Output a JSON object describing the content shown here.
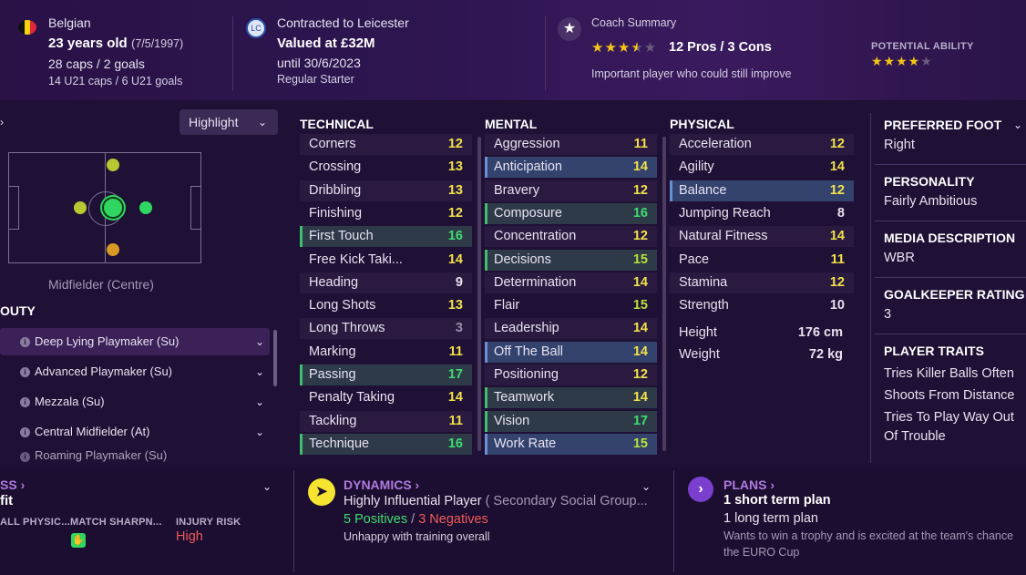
{
  "header": {
    "nationality": "Belgian",
    "age": "23 years old",
    "dob": "(7/5/1997)",
    "caps": "28 caps / 2 goals",
    "u21": "14 U21 caps / 6 U21 goals",
    "contract_title": "Contracted to Leicester",
    "value": "Valued at £32M",
    "until": "until 30/6/2023",
    "status": "Regular Starter",
    "coach_title": "Coach Summary",
    "coach_rating": 3.5,
    "pros_cons": "12 Pros / 3 Cons",
    "coach_note": "Important player who could still improve",
    "pa_label": "POTENTIAL ABILITY",
    "pa_rating": 4
  },
  "position": {
    "highlight_label": "Highlight",
    "position_name": "Midfielder (Centre)",
    "duty_label": "OUTY",
    "roles": [
      "Deep Lying Playmaker (Su)",
      "Advanced Playmaker (Su)",
      "Mezzala (Su)",
      "Central Midfielder (At)",
      "Roaming Playmaker (Su)"
    ]
  },
  "attributes": {
    "technical_title": "TECHNICAL",
    "mental_title": "MENTAL",
    "physical_title": "PHYSICAL",
    "technical": [
      {
        "name": "Corners",
        "value": "12"
      },
      {
        "name": "Crossing",
        "value": "13"
      },
      {
        "name": "Dribbling",
        "value": "13"
      },
      {
        "name": "Finishing",
        "value": "12"
      },
      {
        "name": "First Touch",
        "value": "16"
      },
      {
        "name": "Free Kick Taki...",
        "value": "14"
      },
      {
        "name": "Heading",
        "value": "9"
      },
      {
        "name": "Long Shots",
        "value": "13"
      },
      {
        "name": "Long Throws",
        "value": "3"
      },
      {
        "name": "Marking",
        "value": "11"
      },
      {
        "name": "Passing",
        "value": "17"
      },
      {
        "name": "Penalty Taking",
        "value": "14"
      },
      {
        "name": "Tackling",
        "value": "11"
      },
      {
        "name": "Technique",
        "value": "16"
      }
    ],
    "mental": [
      {
        "name": "Aggression",
        "value": "11"
      },
      {
        "name": "Anticipation",
        "value": "14"
      },
      {
        "name": "Bravery",
        "value": "12"
      },
      {
        "name": "Composure",
        "value": "16"
      },
      {
        "name": "Concentration",
        "value": "12"
      },
      {
        "name": "Decisions",
        "value": "15"
      },
      {
        "name": "Determination",
        "value": "14"
      },
      {
        "name": "Flair",
        "value": "15"
      },
      {
        "name": "Leadership",
        "value": "14"
      },
      {
        "name": "Off The Ball",
        "value": "14"
      },
      {
        "name": "Positioning",
        "value": "12"
      },
      {
        "name": "Teamwork",
        "value": "14"
      },
      {
        "name": "Vision",
        "value": "17"
      },
      {
        "name": "Work Rate",
        "value": "15"
      }
    ],
    "physical": [
      {
        "name": "Acceleration",
        "value": "12"
      },
      {
        "name": "Agility",
        "value": "14"
      },
      {
        "name": "Balance",
        "value": "12"
      },
      {
        "name": "Jumping Reach",
        "value": "8"
      },
      {
        "name": "Natural Fitness",
        "value": "14"
      },
      {
        "name": "Pace",
        "value": "11"
      },
      {
        "name": "Stamina",
        "value": "12"
      },
      {
        "name": "Strength",
        "value": "10"
      }
    ],
    "height_label": "Height",
    "height": "176 cm",
    "weight_label": "Weight",
    "weight": "72 kg"
  },
  "side": {
    "foot_label": "PREFERRED FOOT",
    "foot": "Right",
    "personality_label": "PERSONALITY",
    "personality": "Fairly Ambitious",
    "media_label": "MEDIA DESCRIPTION",
    "media": "WBR",
    "gk_label": "GOALKEEPER RATING",
    "gk": "3",
    "traits_label": "PLAYER TRAITS",
    "traits": [
      "Tries Killer Balls Often",
      "Shoots From Distance",
      "Tries To Play Way Out Of Trouble"
    ]
  },
  "bottom": {
    "fitness_link": "SS",
    "fitness_value": "fit",
    "cap1": "ALL PHYSIC...",
    "cap2": "MATCH SHARPN...",
    "cap3": "INJURY RISK",
    "injury": "High",
    "dynamics_link": "DYNAMICS",
    "dynamics_title": "Highly Influential Player",
    "dynamics_sub": "( Secondary Social Group...",
    "positives": "5 Positives",
    "slash": "/",
    "negatives": "3 Negatives",
    "dynamics_note": "Unhappy with training overall",
    "plans_link": "PLANS",
    "plan1": "1 short term plan",
    "plan2": "1 long term plan",
    "plan_note": "Wants to win a trophy and is excited at the team's chance",
    "plan_note2": "the EURO Cup"
  }
}
